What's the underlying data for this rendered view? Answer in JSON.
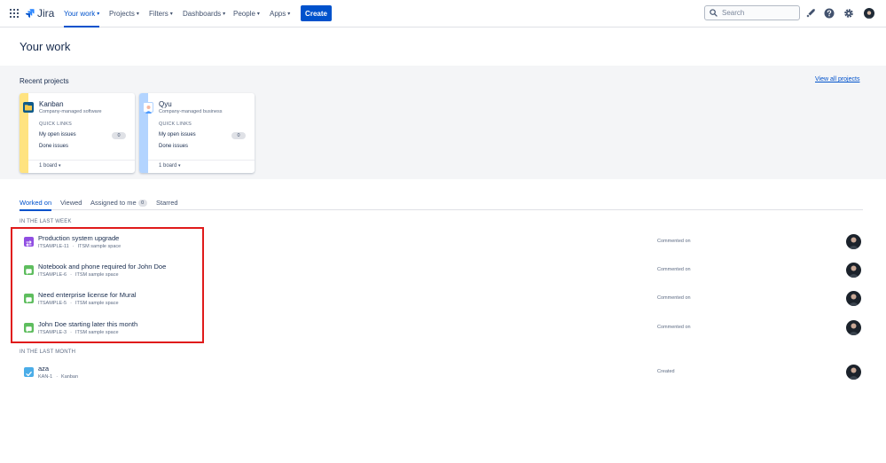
{
  "nav": {
    "product": "Jira",
    "items": [
      {
        "label": "Your work",
        "active": true
      },
      {
        "label": "Projects"
      },
      {
        "label": "Filters"
      },
      {
        "label": "Dashboards"
      },
      {
        "label": "People"
      },
      {
        "label": "Apps"
      }
    ],
    "create_label": "Create",
    "search_placeholder": "Search"
  },
  "page_title": "Your work",
  "recent": {
    "title": "Recent projects",
    "view_all": "View all projects",
    "projects": [
      {
        "name": "Kanban",
        "type": "Company-managed software",
        "quick_links": "QUICK LINKS",
        "open_issues_label": "My open issues",
        "open_issues_count": "0",
        "done_issues_label": "Done issues",
        "board_label": "1 board",
        "stripe_color": "#ffe380",
        "avatar_color": "#0e5a8a"
      },
      {
        "name": "Qyu",
        "type": "Company-managed business",
        "quick_links": "QUICK LINKS",
        "open_issues_label": "My open issues",
        "open_issues_count": "0",
        "done_issues_label": "Done issues",
        "board_label": "1 board",
        "stripe_color": "#b3d4ff",
        "avatar_color": "#4c9aff"
      }
    ]
  },
  "tabs": [
    {
      "label": "Worked on",
      "active": true
    },
    {
      "label": "Viewed"
    },
    {
      "label": "Assigned to me",
      "badge": "0"
    },
    {
      "label": "Starred"
    }
  ],
  "groups": {
    "last_week": "IN THE LAST WEEK",
    "last_month": "IN THE LAST MONTH"
  },
  "issues_week": [
    {
      "title": "Production system upgrade",
      "key": "ITSAMPLE-11",
      "space": "ITSM sample space",
      "action": "Commented on",
      "icon": "change-icon",
      "icon_color": "#904ee2"
    },
    {
      "title": "Notebook and phone required for John Doe",
      "key": "ITSAMPLE-6",
      "space": "ITSM sample space",
      "action": "Commented on",
      "icon": "service-request-icon",
      "icon_color": "#5ebd5e"
    },
    {
      "title": "Need enterprise license for Mural",
      "key": "ITSAMPLE-5",
      "space": "ITSM sample space",
      "action": "Commented on",
      "icon": "service-request-icon",
      "icon_color": "#5ebd5e"
    },
    {
      "title": "John Doe starting later this month",
      "key": "ITSAMPLE-3",
      "space": "ITSM sample space",
      "action": "Commented on",
      "icon": "service-request-icon",
      "icon_color": "#5ebd5e"
    }
  ],
  "issues_month": [
    {
      "title": "aza",
      "key": "KAN-1",
      "space": "Kanban",
      "action": "Created",
      "icon": "task-icon",
      "icon_color": "#4bade8"
    }
  ],
  "colors": {
    "accent": "#0052cc",
    "highlight": "#e01b1b"
  }
}
